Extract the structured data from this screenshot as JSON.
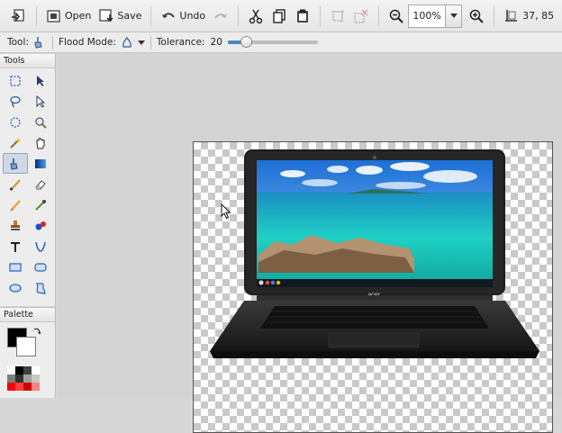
{
  "toolbar": {
    "new_label": "",
    "open_label": "Open",
    "save_label": "Save",
    "undo_label": "Undo",
    "zoom_value": "100%",
    "cursor_position": "37, 85"
  },
  "options": {
    "tool_label": "Tool:",
    "flood_mode_label": "Flood Mode:",
    "tolerance_label": "Tolerance:",
    "tolerance_value": "20",
    "tolerance_fraction": 0.2
  },
  "panels": {
    "tools_title": "Tools",
    "palette_title": "Palette"
  },
  "tools": [
    "rectangle-select-icon",
    "move-selected-icon",
    "lasso-select-icon",
    "move-selection-icon",
    "ellipse-select-icon",
    "zoom-icon",
    "magic-wand-icon",
    "pan-icon",
    "paint-bucket-icon",
    "gradient-icon",
    "paintbrush-icon",
    "eraser-icon",
    "pencil-icon",
    "color-picker-icon",
    "clone-stamp-icon",
    "recolor-icon",
    "text-icon",
    "line-curve-icon",
    "rectangle-icon",
    "rounded-rectangle-icon",
    "ellipse-icon",
    "freeform-shape-icon"
  ],
  "active_tool": "paint-bucket-icon",
  "palette": {
    "primary_color": "#000000",
    "secondary_color": "#ffffff",
    "swatches": [
      "#ffffff",
      "#000000",
      "#404040",
      "#ffffff",
      "#7f7f7f",
      "#303030",
      "#a0a0a0",
      "#c8c8c8",
      "#ff0000",
      "#ff4040",
      "#d00000",
      "#ff8080"
    ]
  },
  "screen": {
    "logo_text": "acer"
  }
}
